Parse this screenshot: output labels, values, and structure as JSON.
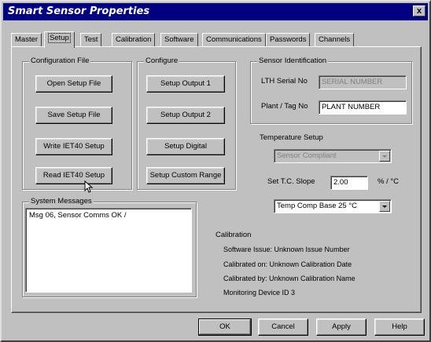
{
  "window": {
    "title": "Smart Sensor Properties",
    "close_label": "x"
  },
  "tabs": [
    "Master",
    "Setup",
    "Test",
    "Calibration",
    "Software",
    "Communications",
    "Passwords",
    "Channels"
  ],
  "config_file": {
    "legend": "Configuration File",
    "open": "Open Setup File",
    "save": "Save Setup File",
    "write": "Write IET40 Setup",
    "read": "Read IET40 Setup"
  },
  "configure": {
    "legend": "Configure",
    "output1": "Setup Output 1",
    "output2": "Setup Output 2",
    "digital": "Setup Digital",
    "custom_range": "Setup Custom Range"
  },
  "sensor_id": {
    "legend": "Sensor Identification",
    "serial_label": "LTH Serial No",
    "serial_value": "SERIAL NUMBER",
    "tag_label": "Plant / Tag No",
    "tag_value": "PLANT NUMBER"
  },
  "temperature": {
    "title": "Temperature Setup",
    "mode_value": "Sensor Compliant",
    "slope_label": "Set T.C. Slope",
    "slope_value": "2.00",
    "slope_unit": "% / °C",
    "comp_base_value": "Temp Comp Base 25 °C"
  },
  "system_messages": {
    "legend": "System Messages",
    "lines": [
      "Msg 06, Sensor Comms OK   /"
    ]
  },
  "calibration": {
    "title": "Calibration",
    "lines": [
      "Software Issue: Unknown Issue Number",
      "Calibrated on: Unknown Calibration Date",
      "Calibrated by: Unknown Calibration Name",
      "Monitoring Device ID 3"
    ]
  },
  "footer": {
    "ok": "OK",
    "cancel": "Cancel",
    "apply": "Apply",
    "help": "Help"
  }
}
